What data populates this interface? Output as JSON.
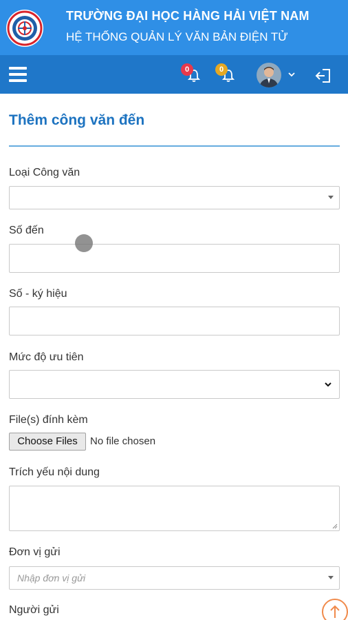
{
  "header": {
    "title_line_1": "TRƯỜNG ĐẠI HỌC HÀNG HẢI VIỆT NAM",
    "title_line_2": "HỆ THỐNG QUẢN LÝ VĂN BẢN ĐIỆN TỬ",
    "bg_color": "#2f8fe6"
  },
  "navbar": {
    "bg_color": "#1f77c9",
    "notifications": [
      {
        "count": "0",
        "badge_color": "#e8394c",
        "icon": "bell-icon"
      },
      {
        "count": "0",
        "badge_color": "#e5a823",
        "icon": "bell-icon"
      }
    ],
    "avatar_icon": "user-avatar",
    "logout_icon": "logout-icon"
  },
  "page": {
    "title": "Thêm công văn đến",
    "accent_color": "#1d73c0"
  },
  "form": {
    "loai_cong_van": {
      "label": "Loại Công văn",
      "value": ""
    },
    "so_den": {
      "label": "Số đến",
      "value": ""
    },
    "so_ky_hieu": {
      "label": "Số - ký hiệu",
      "value": ""
    },
    "muc_do_uu_tien": {
      "label": "Mức độ ưu tiên",
      "value": ""
    },
    "files": {
      "label": "File(s) đính kèm",
      "button": "Choose Files",
      "status": "No file chosen"
    },
    "trich_yeu": {
      "label": "Trích yếu nội dung",
      "value": ""
    },
    "don_vi_gui": {
      "label": "Đơn vị gửi",
      "placeholder": "Nhập đơn vị gửi"
    },
    "nguoi_gui": {
      "label": "Người gửi"
    }
  }
}
